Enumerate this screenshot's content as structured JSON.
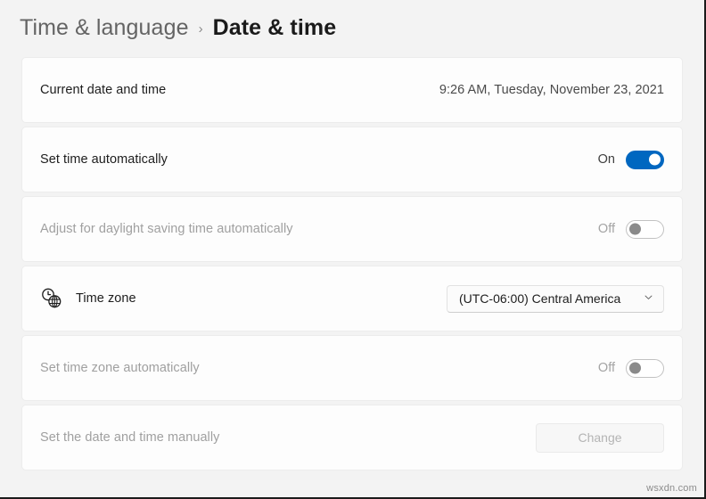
{
  "breadcrumb": {
    "parent": "Time & language",
    "separator": "›",
    "current": "Date & time"
  },
  "rows": {
    "current_datetime": {
      "label": "Current date and time",
      "value": "9:26 AM, Tuesday, November 23, 2021"
    },
    "set_time_auto": {
      "label": "Set time automatically",
      "state": "On"
    },
    "daylight_saving": {
      "label": "Adjust for daylight saving time automatically",
      "state": "Off"
    },
    "time_zone": {
      "label": "Time zone",
      "icon": "clock-globe-icon",
      "selected": "(UTC-06:00) Central America",
      "chevron": "chevron-down-icon"
    },
    "set_timezone_auto": {
      "label": "Set time zone automatically",
      "state": "Off"
    },
    "set_manually": {
      "label": "Set the date and time manually",
      "button": "Change"
    }
  },
  "watermark": "wsxdn.com",
  "colors": {
    "accent": "#0067c0",
    "page_background": "#f3f3f3",
    "card_background": "#fdfdfd",
    "disabled_text": "#a0a0a0"
  }
}
